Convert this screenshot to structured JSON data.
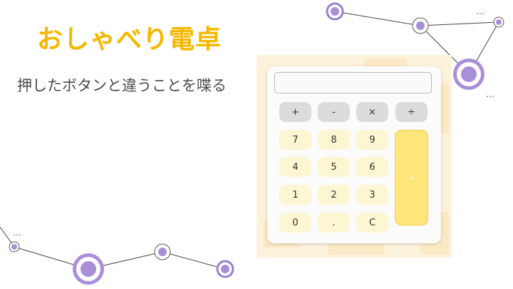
{
  "title": "おしゃべり電卓",
  "subtitle": "押したボタンと違うことを喋る",
  "calculator": {
    "display_value": "",
    "operator_keys": [
      {
        "name": "plus",
        "label": "+"
      },
      {
        "name": "minus",
        "label": "-"
      },
      {
        "name": "multiply",
        "label": "×"
      },
      {
        "name": "divide",
        "label": "÷"
      }
    ],
    "digit_keys": [
      "7",
      "8",
      "9",
      "4",
      "5",
      "6",
      "1",
      "2",
      "3",
      "0",
      ".",
      "C"
    ],
    "equals_label": "="
  },
  "decor": {
    "ellipsis": "…",
    "accent_color": "#f5b800",
    "node_color": "#a98fd8"
  }
}
